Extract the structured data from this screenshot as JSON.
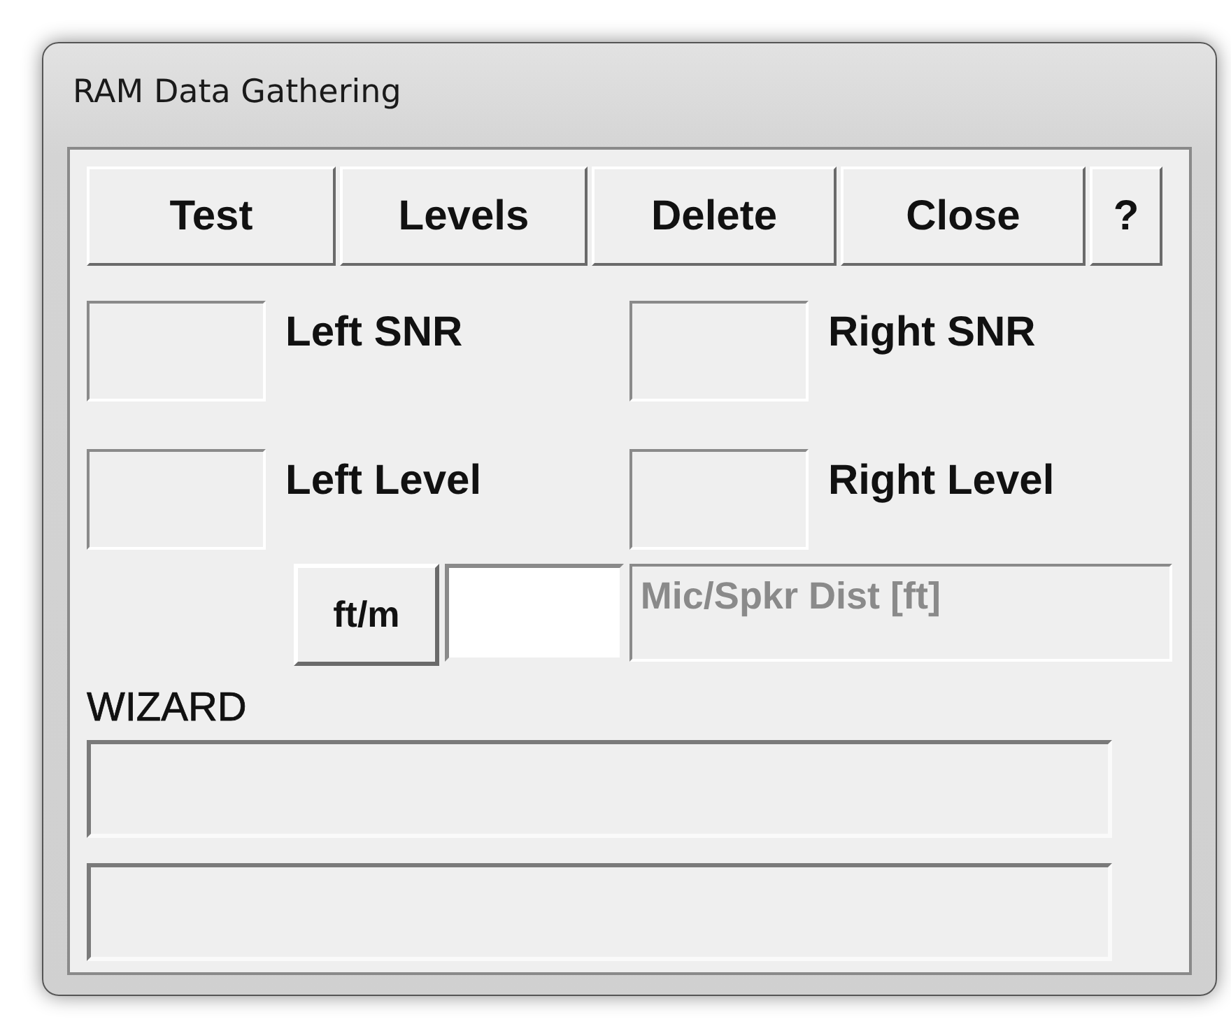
{
  "window": {
    "title": "RAM Data Gathering"
  },
  "buttons": [
    {
      "label": "Test"
    },
    {
      "label": "Levels"
    },
    {
      "label": "Delete"
    },
    {
      "label": "Close"
    },
    {
      "label": "?"
    }
  ],
  "readouts": [
    {
      "label": "Left SNR"
    },
    {
      "label": "Right SNR"
    },
    {
      "label": "Left Level"
    },
    {
      "label": "Right Level"
    }
  ],
  "distance": {
    "unit_button": "ft/m",
    "caption": "Mic/Spkr Dist [ft]"
  },
  "wizard": {
    "label": "WIZARD"
  }
}
